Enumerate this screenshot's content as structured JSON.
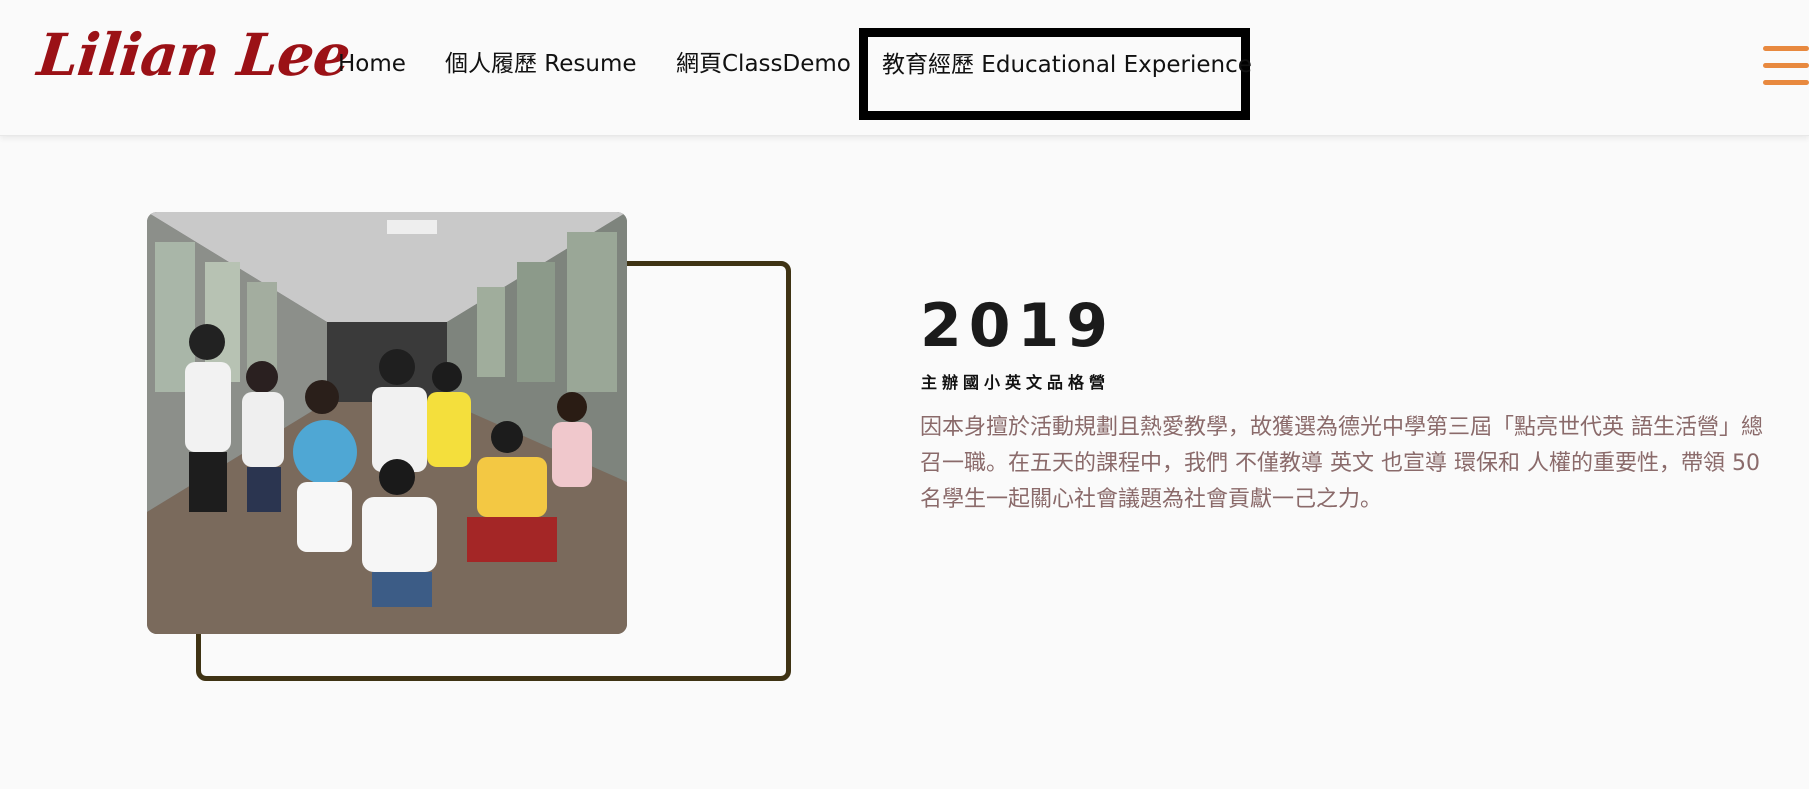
{
  "header": {
    "logo_text": "Lilian Lee",
    "nav": [
      {
        "label": "Home"
      },
      {
        "label": "個人履歷 Resume"
      },
      {
        "label": "網頁ClassDemo"
      },
      {
        "label": "教育經歷 Educational Experience",
        "active": true
      }
    ],
    "menu_icon": "hamburger-menu-icon"
  },
  "main": {
    "photo_description": "group-photo",
    "year": "2019",
    "subtitle": "主辦國小英文品格營",
    "description": "因本身擅於活動規劃且熱愛教學，故獲選為德光中學第三屆「點亮世代英 語生活營」總召一職。在五天的課程中，我們 不僅教導 英文 也宣導 環保和 人權的重要性，帶領 50 名學生一起關心社會議題為社會貢獻一己之力。"
  },
  "colors": {
    "logo": "#9b1116",
    "frame_border": "#3f3314",
    "hamburger": "#e8893f",
    "description_text": "#8a6a6a",
    "background": "#fafafa"
  }
}
